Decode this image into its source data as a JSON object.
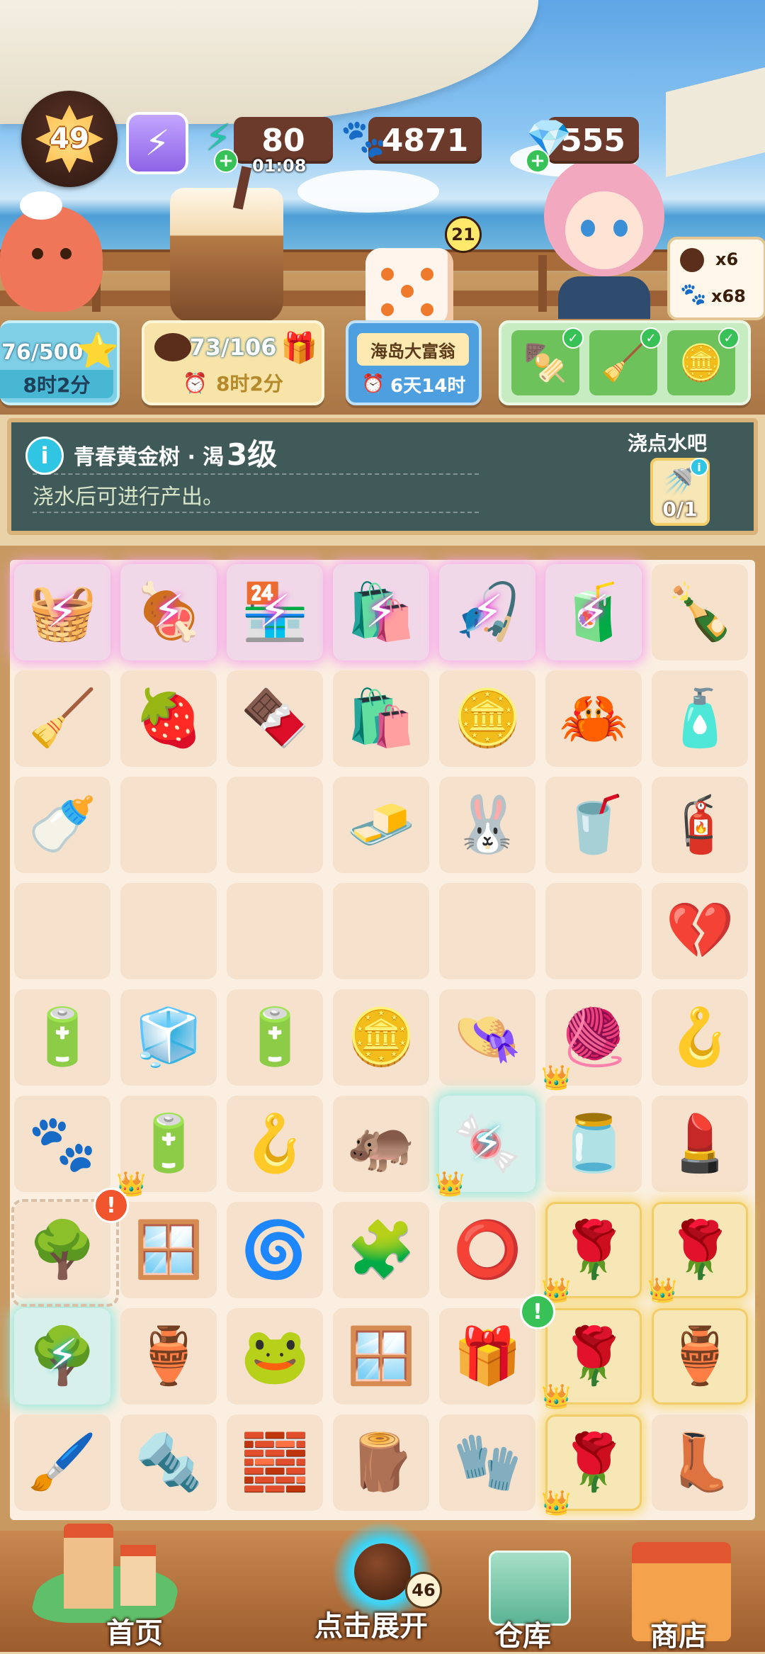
{
  "hud": {
    "level": "49",
    "energy": "80",
    "energy_timer": "01:08",
    "paws": "4871",
    "gems": "555"
  },
  "scene": {
    "dice_count": "21",
    "side_panel": {
      "cookie_count": "x6",
      "paw_count": "x68"
    }
  },
  "task_cards": [
    {
      "value": "76/500",
      "time": "8时2分"
    },
    {
      "value": "73/106",
      "time": "8时2分"
    },
    {
      "title": "海岛大富翁",
      "time": "6天14时"
    }
  ],
  "info": {
    "item_name": "青春黄金树 · 渴",
    "level": "3级",
    "description": "浇水后可进行产出。",
    "action_title": "浇点水吧",
    "action_progress": "0/1"
  },
  "board": {
    "rows": [
      [
        "🧺",
        "🍖",
        "🏪",
        "🛍️",
        "🎣",
        "🧃",
        "🍾"
      ],
      [
        "🧹",
        "🍓",
        "🍫",
        "🛍️",
        "🪙",
        "🦀",
        "🧴"
      ],
      [
        "🍼",
        "",
        "",
        "🧈",
        "🐰",
        "🥤",
        "🧯"
      ],
      [
        "",
        "",
        "",
        "",
        "",
        "",
        "💔"
      ],
      [
        "🔋",
        "🧊",
        "🔋",
        "🪙",
        "👒",
        "🧶",
        "🪝"
      ],
      [
        "🐾",
        "🔋",
        "🪝",
        "🦛",
        "🍬",
        "🫙",
        "💄"
      ],
      [
        "🌳",
        "🪟",
        "🌀",
        "🧩",
        "⭕",
        "🌹",
        "🌹"
      ],
      [
        "🌳",
        "🏺",
        "🐸",
        "🪟",
        "🎁",
        "🌹",
        "🏺"
      ],
      [
        "🖌️",
        "🔩",
        "🧱",
        "🪵",
        "🧤",
        "🌹",
        "👢"
      ]
    ]
  },
  "nav": {
    "home": "首页",
    "expand": "点击展开",
    "expand_badge": "46",
    "storage": "仓库",
    "shop": "商店"
  },
  "colors": {
    "accent_green": "#38c157",
    "panel": "#3f5a58",
    "board_bg": "#fbefe1"
  }
}
